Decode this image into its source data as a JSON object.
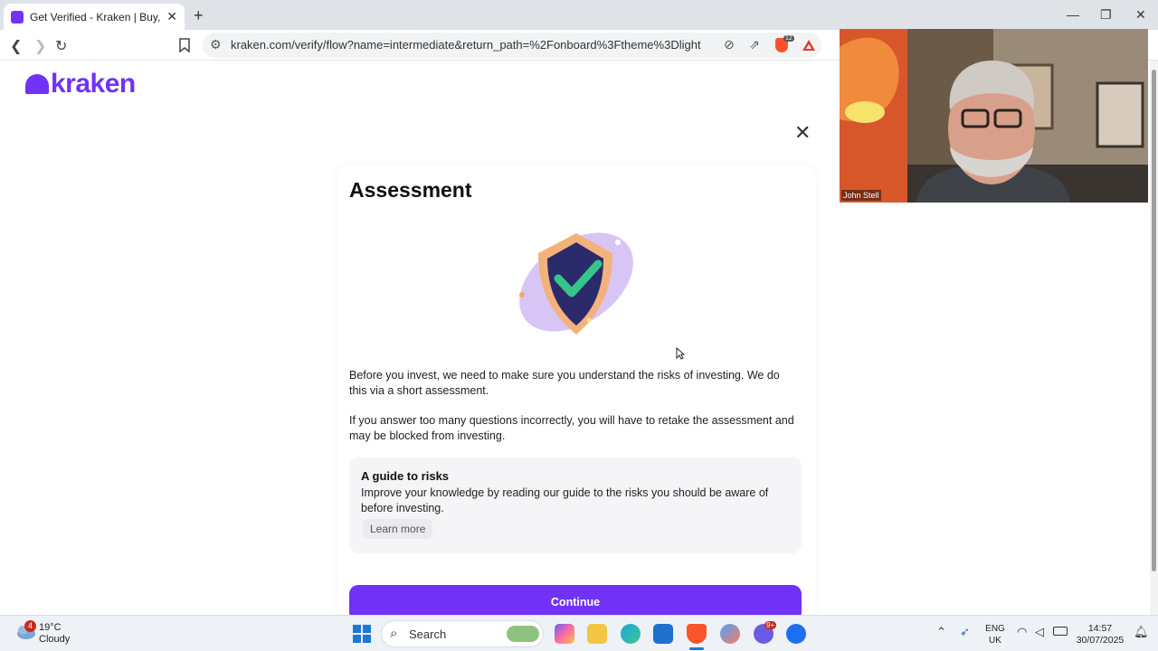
{
  "browser": {
    "tab_title": "Get Verified - Kraken | Buy, Sell a",
    "url": "kraken.com/verify/flow?name=intermediate&return_path=%2Fonboard%3Ftheme%3Dlight",
    "shield_badge": "12"
  },
  "page": {
    "logo": "kraken",
    "title": "Assessment",
    "para1": "Before you invest, we need to make sure you understand the risks of investing. We do this via a short assessment.",
    "para2": "If you answer too many questions incorrectly, you will have to retake the assessment and may be blocked from investing.",
    "guide": {
      "title": "A guide to risks",
      "text": "Improve your knowledge by reading our guide to the risks you should be aware of before investing.",
      "link": "Learn more"
    },
    "continue": "Continue",
    "accent": "#7132f5"
  },
  "video": {
    "name": "John Stell"
  },
  "taskbar": {
    "weather_temp": "19°C",
    "weather_desc": "Cloudy",
    "weather_badge": "4",
    "search": "Search",
    "lang1": "ENG",
    "lang2": "UK",
    "time": "14:57",
    "date": "30/07/2025",
    "chat_badge": "9+"
  }
}
